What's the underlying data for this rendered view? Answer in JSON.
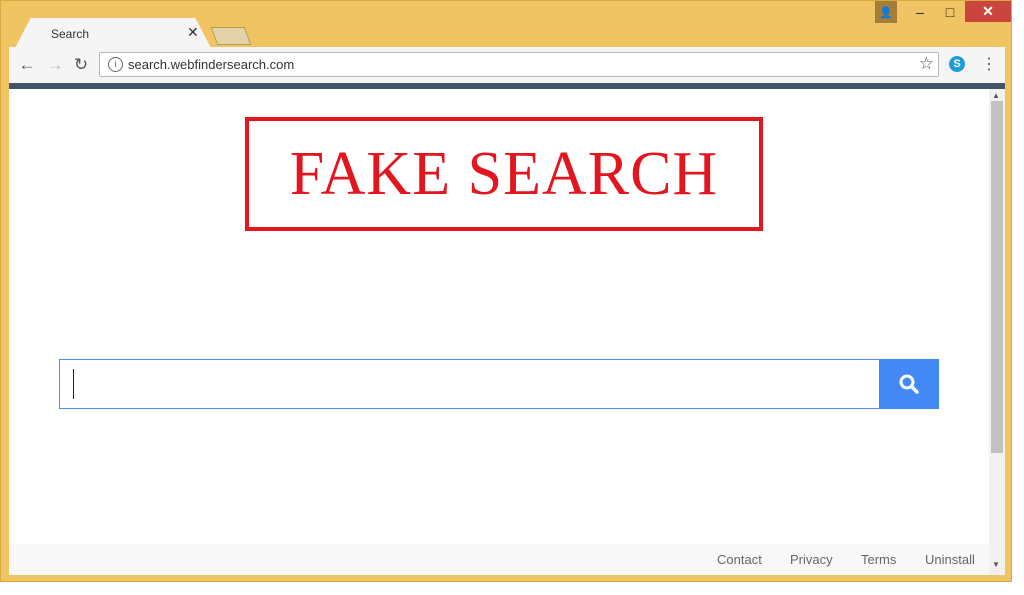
{
  "tab": {
    "title": "Search",
    "close_symbol": "✕"
  },
  "address": {
    "url": "search.webfindersearch.com"
  },
  "logo": {
    "text": "FAKE SEARCH"
  },
  "search": {
    "value": "",
    "placeholder": ""
  },
  "footer": {
    "links": [
      "Contact",
      "Privacy",
      "Terms",
      "Uninstall"
    ]
  },
  "colors": {
    "frame": "#f0c463",
    "logo_red": "#e3151f",
    "search_button": "#4289f5",
    "dark_bar": "#45536a"
  },
  "icons": [
    "back-icon",
    "forward-icon",
    "reload-icon",
    "info-icon",
    "star-icon",
    "skype-icon",
    "menu-icon",
    "search-icon"
  ]
}
